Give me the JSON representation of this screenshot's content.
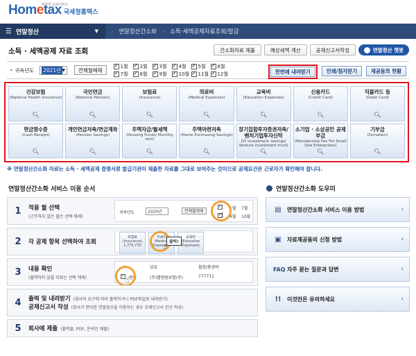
{
  "header": {
    "logo_main": "Hom",
    "logo_e": "e",
    "logo_tail": "tax",
    "logo_ko": "국세청홈택스",
    "logo_tagline": "편리한 납세서비스",
    "menu_label": "연말정산",
    "crumbs": [
      "연말정산간소화",
      "소득·세액공제자료조회/발급"
    ]
  },
  "title_row": {
    "title": "소득 · 세액공제 자료 조회",
    "buttons": [
      "간소화자료 제출",
      "예상세액 계산",
      "공제신고서작성"
    ],
    "chatbot_label": "연말정산 챗봇"
  },
  "filter": {
    "year_label": "귀속년도",
    "year_value": "2021년",
    "clear_label": "전체월해제",
    "months": [
      "1월",
      "2월",
      "3월",
      "4월",
      "5월",
      "6월",
      "7월",
      "8월",
      "9월",
      "10월",
      "11월",
      "12월"
    ],
    "download_all": "한번에 내려받기",
    "print_view": "인쇄/점자받기",
    "provider_status": "제공동의 현황"
  },
  "categories": [
    {
      "name": "건강보험",
      "sub": "(National Health Insurance)"
    },
    {
      "name": "국민연금",
      "sub": "(National Pension)"
    },
    {
      "name": "보험료",
      "sub": "(Insurance)"
    },
    {
      "name": "의료비",
      "sub": "(Medical Expenses)"
    },
    {
      "name": "교육비",
      "sub": "(Education Expenses)"
    },
    {
      "name": "신용카드",
      "sub": "(Credit Card)"
    },
    {
      "name": "직불카드 등",
      "sub": "(Debit Card)"
    },
    {
      "name": "현금영수증",
      "sub": "(Cash Receipt)"
    },
    {
      "name": "개인연금저축/연금계좌",
      "sub": "(Pension Savings)"
    },
    {
      "name": "주택자금/월세액",
      "sub": "(Housing Funds/ Monthly rent)"
    },
    {
      "name": "주택마련저축",
      "sub": "(Home Purchasing Savings)"
    },
    {
      "name": "장기집합투자증권저축/벤처기업투자신탁",
      "sub": "(LT investment savings/ Venture investment trust)"
    },
    {
      "name": "소기업 · 소상공인 공제부금",
      "sub": "(Membership Fee For Small Size Enterprises)"
    },
    {
      "name": "기부금",
      "sub": "(Donation)"
    }
  ],
  "notice": "※ 연말정산간소화 자료는 소득 · 세액공제 증명서류 발급기관이 제출한 자료를 그대로 보여주는 것이므로 공제요건은 근로자가 확인해야 합니다.",
  "guide": {
    "title": "연말정산간소화 서비스 이용 순서",
    "steps": [
      {
        "num": "1",
        "title": "적용 월 선택",
        "note": "(근무하지 않은 월은 선택 해제)"
      },
      {
        "num": "2",
        "title": "각 공제 항목 선택하여 조회",
        "note": ""
      },
      {
        "num": "3",
        "title": "내용 확인",
        "note": "(출력하지 않을 자료는 선택 해제)"
      },
      {
        "num": "4",
        "title": "출력 및 내려받기",
        "title2": "공제신고서 작성",
        "note": "(회사의 요구에 따라 출력하거나 PDF파일로 내려받기)",
        "note2": "(회사가 편리한 연말정산을 이용하는 경우 공제신고서 전산 작성)"
      },
      {
        "num": "5",
        "title": "회사에 제출",
        "note": "(출력물, PDF, 온라인 제출)"
      }
    ],
    "mock1": {
      "year_label": "귀속년도",
      "year_value": "2020년",
      "clear_label": "전체월해제",
      "months": [
        "1월",
        "4월",
        "7월",
        "10월"
      ]
    },
    "mock2": {
      "cards": [
        "보험료",
        "의료비",
        "교육비"
      ],
      "subs": [
        "(Insurance)",
        "(Medical Expenses)",
        "(Education Expenses)"
      ],
      "amount": "1,775,770",
      "tooltip": "클릭!"
    },
    "mock3": {
      "col1": "상호",
      "col2": "월정/총경비",
      "row_label": "병원",
      "row_name": "(주)별병원보험(주)",
      "row_value": "777711"
    }
  },
  "help": {
    "title": "연말정산간소화 도우미",
    "items": [
      {
        "icon": "document-icon",
        "label": "연말정산간소화 서비스 이용 방법"
      },
      {
        "icon": "id-card-icon",
        "label": "자료제공동의 신청 방법"
      },
      {
        "icon": "faq-icon",
        "label": "자주 묻는 질문과 답변"
      },
      {
        "icon": "exclamation-icon",
        "label": "이것만은 유의하세요"
      }
    ]
  },
  "colors": {
    "nav": "#2f4b79",
    "accent": "#1f56a8",
    "highlight": "#e0121b",
    "orange": "#f0a23a"
  }
}
